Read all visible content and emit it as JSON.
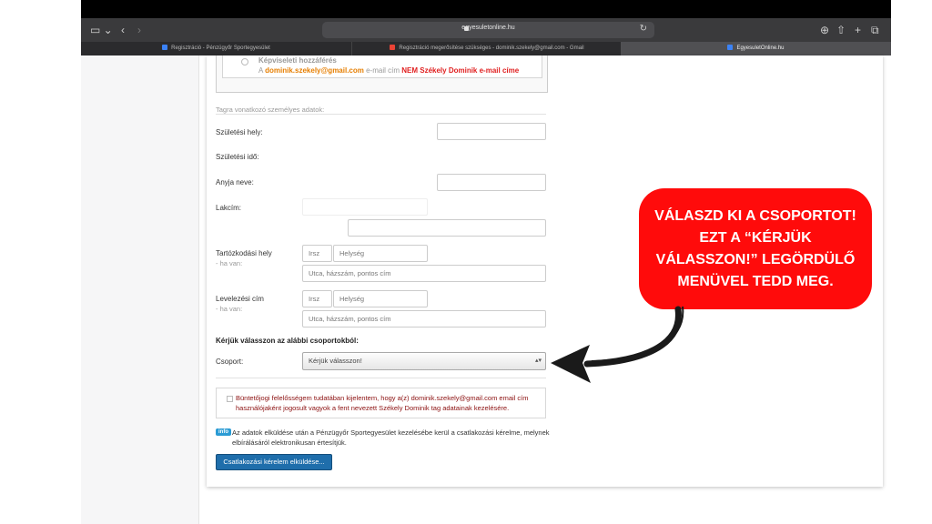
{
  "browser": {
    "url": "egyesuletonline.hu",
    "tabs": [
      {
        "label": "Regisztráció - Pénzügyőr Sportegyesület",
        "active": false,
        "favicon_color": "#3b82f6"
      },
      {
        "label": "Regisztráció megerősítése szükséges - dominik.szekely@gmail.com - Gmail",
        "active": false,
        "favicon_color": "#ea4335"
      },
      {
        "label": "EgyesuletOnline.hu",
        "active": true,
        "favicon_color": "#3b82f6"
      }
    ]
  },
  "form": {
    "representation": {
      "title": "Képviseleti hozzáférés",
      "prefix": "A",
      "email": "dominik.szekely@gmail.com",
      "middle": "e-mail cím",
      "not_text": "NEM Székely Dominik e-mail címe"
    },
    "personal_section_title": "Tagra vonatkozó személyes adatok:",
    "birth_place_label": "Születési hely:",
    "birth_date_label": "Születési idő:",
    "mother_name_label": "Anyja neve:",
    "address_label": "Lakcím:",
    "residence_label": "Tartózkodási hely",
    "residence_sub": "- ha van:",
    "postal_label": "Levelezési cím",
    "postal_sub": "- ha van:",
    "zip_placeholder": "Irsz",
    "city_placeholder": "Helység",
    "street_placeholder": "Utca, házszám, pontos cím",
    "group_section_title": "Kérjük válasszon az alábbi csoportokból:",
    "group_label": "Csoport:",
    "group_selected": "Kérjük válasszon!",
    "consent_text": "Büntetőjogi felelősségem tudatában kijelentem, hogy a(z) dominik.szekely@gmail.com email cím használójaként jogosult vagyok a fent nevezett Székely Dominik tag adatainak kezelésére.",
    "info_badge": "info",
    "info_text": "Az adatok elküldése után a Pénzügyőr Sportegyesület kezelésébe kerül a csatlakozási kérelme, melynek elbírálásáról elektronikusan értesítjük.",
    "submit_label": "Csatlakozási kérelem elküldése..."
  },
  "annotation": {
    "text": "VÁLASZD KI A CSOPORTOT! EZT A “KÉRJÜK VÁLASSZON!” LEGÖRDÜLŐ MENÜVEL TEDD MEG.",
    "bubble_color": "#ff0b0b"
  }
}
